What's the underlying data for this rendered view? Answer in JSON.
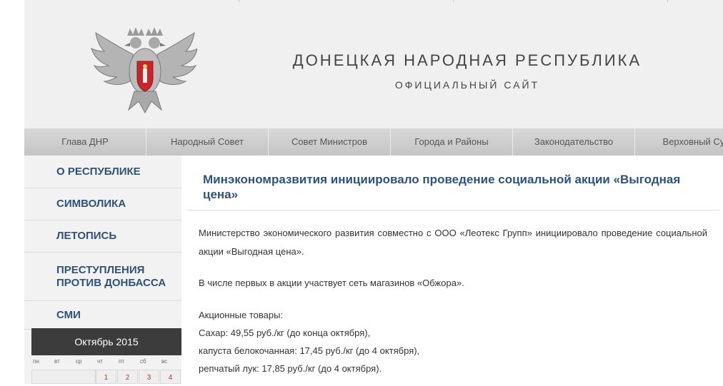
{
  "header": {
    "title": "ДОНЕЦКАЯ НАРОДНАЯ РЕСПУБЛИКА",
    "subtitle": "ОФИЦИАЛЬНЫЙ САЙТ",
    "emblem_icon": "double-headed-eagle-emblem"
  },
  "nav": {
    "items": [
      {
        "label": "Глава ДНР"
      },
      {
        "label": "Народный Совет"
      },
      {
        "label": "Совет Министров"
      },
      {
        "label": "Города и Районы"
      },
      {
        "label": "Законодательство"
      },
      {
        "label": "Верховный Суд"
      }
    ]
  },
  "sidebar": {
    "items": [
      {
        "label": "О РЕСПУБЛИКЕ"
      },
      {
        "label": "СИМВОЛИКА"
      },
      {
        "label": "ЛЕТОПИСЬ"
      },
      {
        "label": "ПРЕСТУПЛЕНИЯ ПРОТИВ ДОНБАССА"
      },
      {
        "label": "СМИ"
      }
    ]
  },
  "calendar": {
    "month": "Октябрь 2015",
    "weekdays": [
      "пн",
      "вт",
      "ср",
      "чт",
      "пт",
      "сб",
      "вс"
    ],
    "first_row": [
      "",
      "",
      "",
      "1",
      "2",
      "3",
      "4"
    ]
  },
  "article": {
    "title": "Минэкономразвития инициировало проведение социальной акции «Выгодная цена»",
    "paragraph1": "Министерство экономического развития совместно с ООО «Леотекс Групп» инициировало проведение социальной акции «Выгодная цена».",
    "paragraph2": "В числе первых в акции участвует сеть магазинов «Обжора».",
    "goods_heading": "Акционные товары:",
    "goods": [
      "Сахар: 49,55 руб./кг (до конца октября),",
      "капуста белокочанная: 17,45 руб./кг (до 4 октября),",
      "репчатый лук: 17,85 руб./кг (до 4 октября)."
    ]
  },
  "colors": {
    "accent": "#2f5277",
    "calendar_header": "#3c3c3c",
    "calendar_day": "#c0302e"
  }
}
